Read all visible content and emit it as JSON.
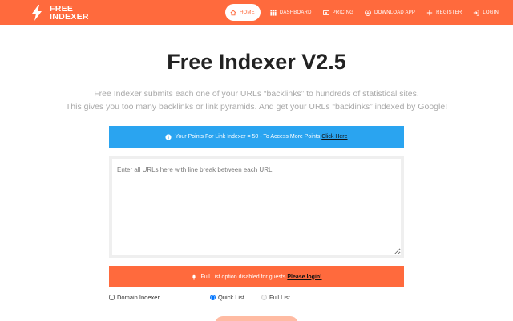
{
  "brand": {
    "line1": "FREE",
    "line2": "INDEXER"
  },
  "nav": [
    {
      "label": "HOME",
      "icon": "home-icon",
      "active": true
    },
    {
      "label": "DASHBOARD",
      "icon": "grid-icon"
    },
    {
      "label": "PRICING",
      "icon": "money-icon"
    },
    {
      "label": "DOWNLOAD APP",
      "icon": "download-icon"
    },
    {
      "label": "REGISTER",
      "icon": "plus-icon"
    },
    {
      "label": "LOGIN",
      "icon": "login-icon"
    }
  ],
  "main": {
    "title": "Free Indexer V2.5",
    "subtitle_line1": "Free Indexer submits each one of your URLs “backlinks” to hundreds of statistical sites.",
    "subtitle_line2": "This gives you too many backlinks or link pyramids. And get your URLs “backlinks” indexed by Google!",
    "points_text": "Your Points For Link Indexer = 50 - To Access More Points",
    "points_link": "Click Here",
    "url_placeholder": "Enter all URLs here with line break between each URL",
    "guest_notice": "Full List option disabled for guests",
    "login_link": "Please login!",
    "options": {
      "domain_indexer": "Domain Indexer",
      "quick_list": "Quick List",
      "full_list": "Full List"
    }
  },
  "colors": {
    "accent": "#ff6a3d",
    "info": "#2aa4f0"
  }
}
